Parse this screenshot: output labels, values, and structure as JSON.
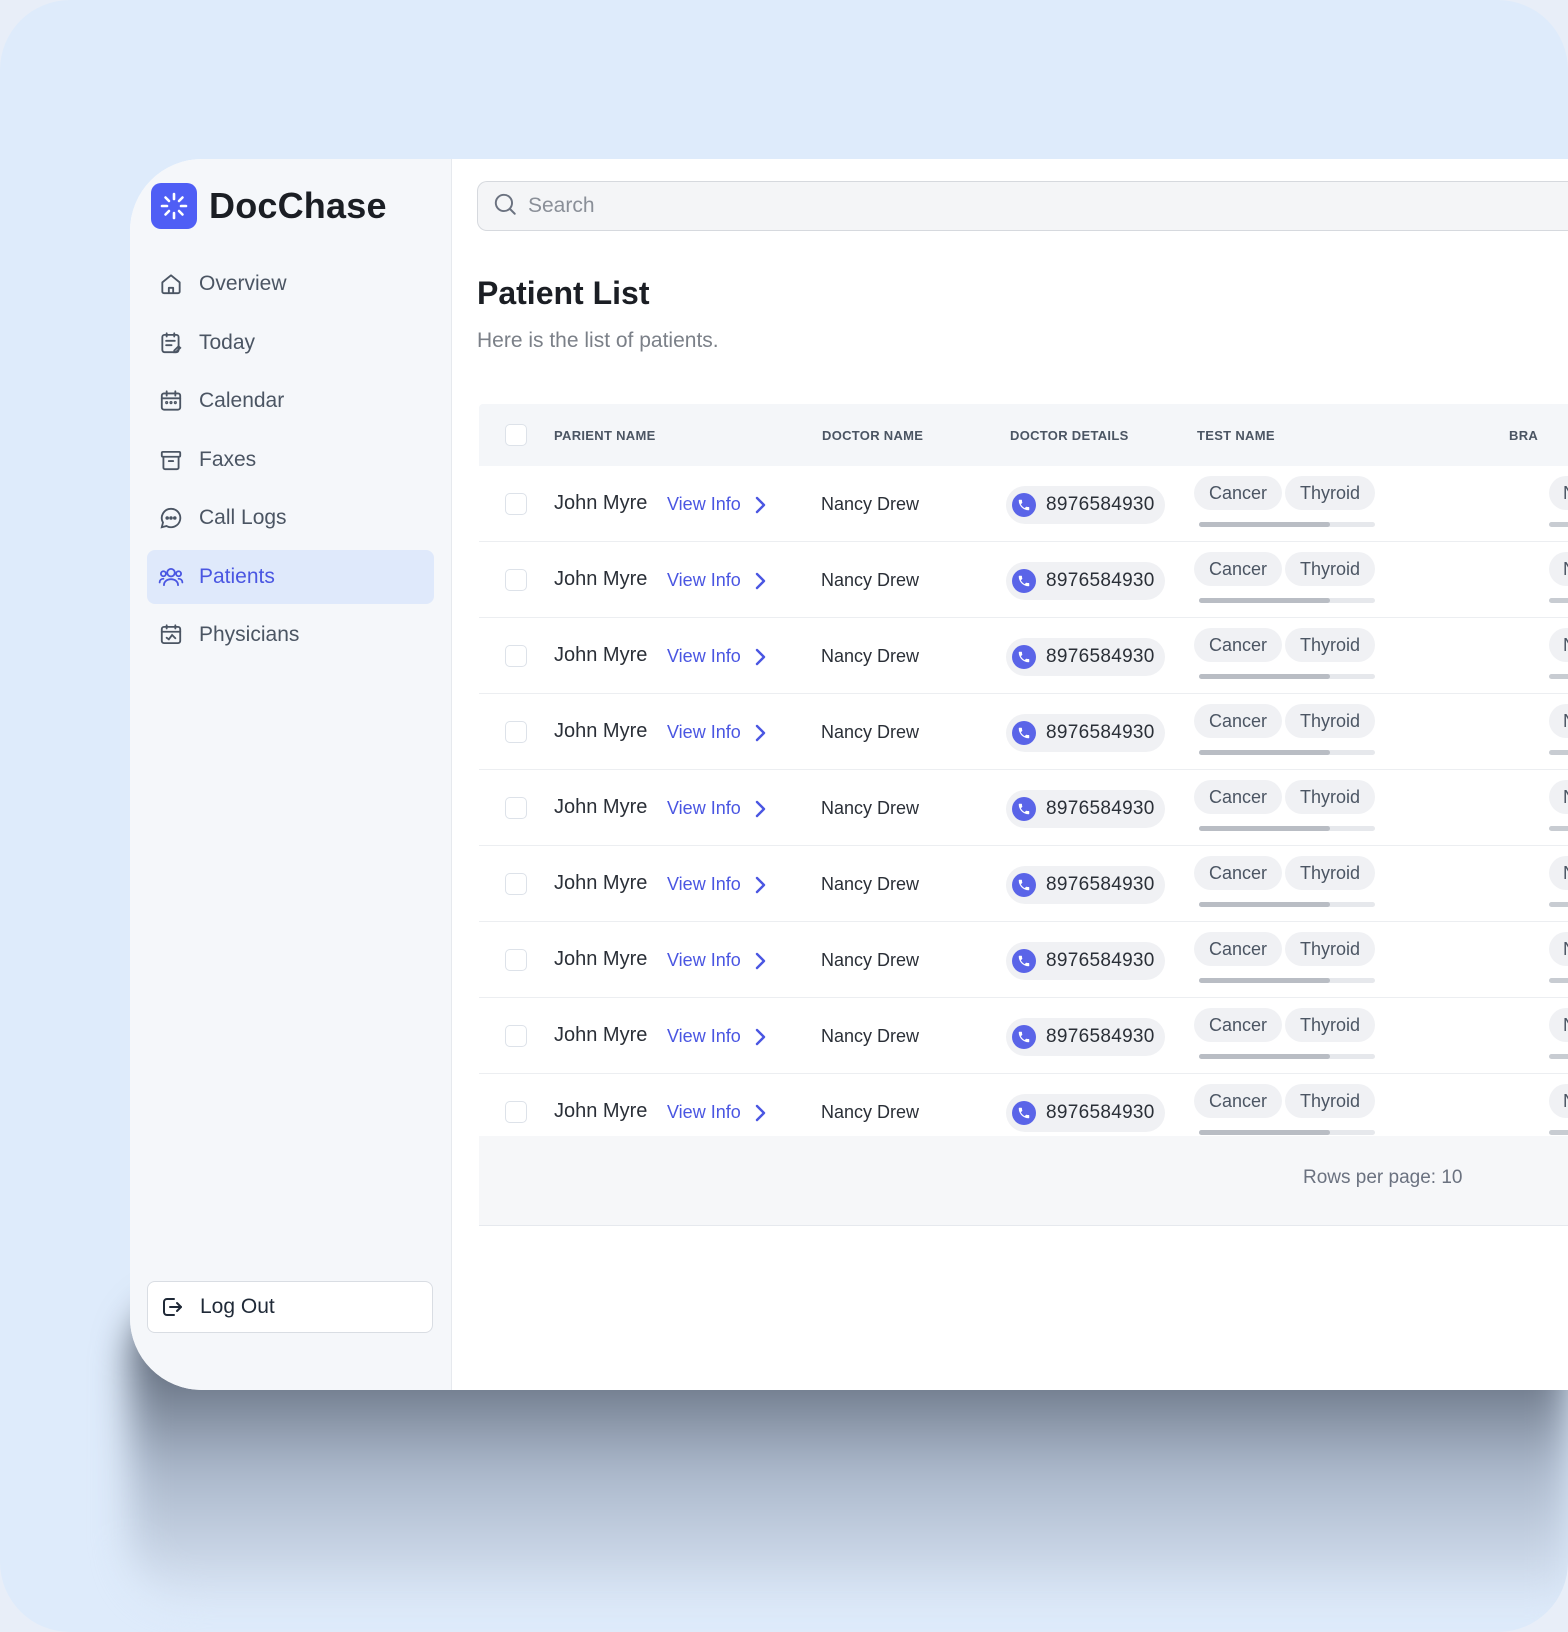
{
  "app": {
    "name": "DocChase"
  },
  "sidebar": {
    "items": [
      {
        "label": "Overview",
        "icon": "home-icon",
        "active": false
      },
      {
        "label": "Today",
        "icon": "calendar-edit-icon",
        "active": false
      },
      {
        "label": "Calendar",
        "icon": "calendar-icon",
        "active": false
      },
      {
        "label": "Faxes",
        "icon": "archive-icon",
        "active": false
      },
      {
        "label": "Call Logs",
        "icon": "chat-bubble-icon",
        "active": false
      },
      {
        "label": "Patients",
        "icon": "users-icon",
        "active": true
      },
      {
        "label": "Physicians",
        "icon": "id-card-icon",
        "active": false
      }
    ],
    "logout_label": "Log Out"
  },
  "search": {
    "placeholder": "Search"
  },
  "page": {
    "title": "Patient List",
    "subtitle": "Here is the list of patients."
  },
  "table": {
    "columns": [
      "PARIENT NAME",
      "DOCTOR NAME",
      "DOCTOR DETAILS",
      "TEST NAME",
      "BRA"
    ],
    "view_info_label": "View Info",
    "rows": [
      {
        "patient": "John Myre",
        "doctor": "Nancy Drew",
        "phone": "8976584930",
        "tests": [
          "Cancer",
          "Thyroid"
        ],
        "col6": "N"
      },
      {
        "patient": "John Myre",
        "doctor": "Nancy Drew",
        "phone": "8976584930",
        "tests": [
          "Cancer",
          "Thyroid"
        ],
        "col6": "N"
      },
      {
        "patient": "John Myre",
        "doctor": "Nancy Drew",
        "phone": "8976584930",
        "tests": [
          "Cancer",
          "Thyroid"
        ],
        "col6": "N"
      },
      {
        "patient": "John Myre",
        "doctor": "Nancy Drew",
        "phone": "8976584930",
        "tests": [
          "Cancer",
          "Thyroid"
        ],
        "col6": "N"
      },
      {
        "patient": "John Myre",
        "doctor": "Nancy Drew",
        "phone": "8976584930",
        "tests": [
          "Cancer",
          "Thyroid"
        ],
        "col6": "N"
      },
      {
        "patient": "John Myre",
        "doctor": "Nancy Drew",
        "phone": "8976584930",
        "tests": [
          "Cancer",
          "Thyroid"
        ],
        "col6": "N"
      },
      {
        "patient": "John Myre",
        "doctor": "Nancy Drew",
        "phone": "8976584930",
        "tests": [
          "Cancer",
          "Thyroid"
        ],
        "col6": "N"
      },
      {
        "patient": "John Myre",
        "doctor": "Nancy Drew",
        "phone": "8976584930",
        "tests": [
          "Cancer",
          "Thyroid"
        ],
        "col6": "N"
      },
      {
        "patient": "John Myre",
        "doctor": "Nancy Drew",
        "phone": "8976584930",
        "tests": [
          "Cancer",
          "Thyroid"
        ],
        "col6": "N"
      }
    ],
    "footer": {
      "rows_per_page_label": "Rows per page: 10"
    }
  },
  "colors": {
    "accent": "#4a56e2",
    "brand": "#4f5ef5",
    "active_bg": "#dfe9fb",
    "backdrop": "#deebfb"
  }
}
